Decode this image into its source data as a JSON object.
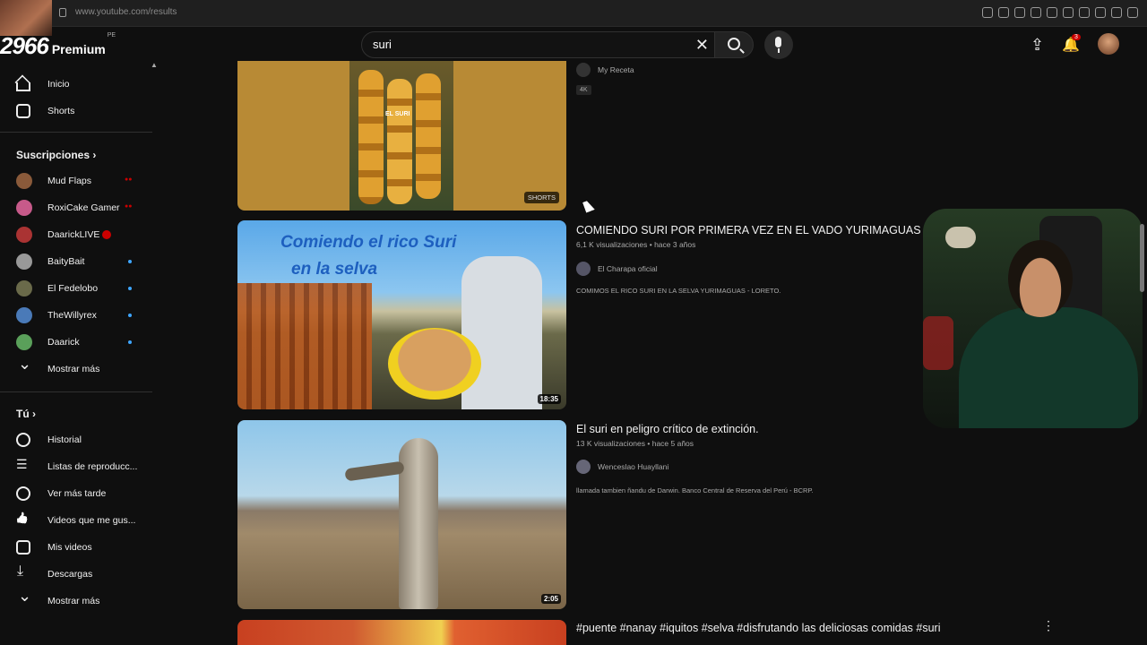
{
  "browser": {
    "url": "www.youtube.com/results"
  },
  "header": {
    "logo_number": "2966",
    "logo_label": "Premium",
    "logo_country": "PE",
    "search_value": "suri",
    "notification_count": "3"
  },
  "sidebar": {
    "main": [
      {
        "label": "Inicio",
        "icon": "home-icon"
      },
      {
        "label": "Shorts",
        "icon": "shorts-icon"
      }
    ],
    "subscriptions_header": "Suscripciones",
    "subscriptions": [
      {
        "label": "Mud Flaps",
        "color": "#8a5a3a"
      },
      {
        "label": "RoxiCake Gamer",
        "color": "#c75a8a"
      },
      {
        "label": "DaarickLIVE",
        "color": "#a33"
      },
      {
        "label": "BaityBait",
        "color": "#999"
      },
      {
        "label": "El Fedelobo",
        "color": "#6a6a4a"
      },
      {
        "label": "TheWillyrex",
        "color": "#4a7ab8"
      },
      {
        "label": "Daarick",
        "color": "#5aa05a"
      }
    ],
    "show_more_1": "Mostrar más",
    "you_header": "Tú",
    "you_items": [
      {
        "label": "Historial"
      },
      {
        "label": "Listas de reproducc..."
      },
      {
        "label": "Ver más tarde"
      },
      {
        "label": "Videos que me gus..."
      },
      {
        "label": "Mis videos"
      },
      {
        "label": "Descargas"
      }
    ],
    "show_more_2": "Mostrar más"
  },
  "results": [
    {
      "channel": "My Receta",
      "tag": "4K",
      "badge": "SHORTS",
      "thumb_overlay": "EL SURI"
    },
    {
      "title": "COMIENDO SURI POR PRIMERA VEZ EN EL VADO YURIMAGUAS - LORETO",
      "meta": "6,1 K visualizaciones • hace 3 años",
      "channel": "El Charapa oficial",
      "description": "COMIMOS EL RICO SURI EN LA SELVA YURIMAGUAS - LORETO.",
      "duration": "18:35",
      "thumb_line1": "Comiendo el rico Suri",
      "thumb_line2": "en la selva"
    },
    {
      "title": "El suri en peligro crítico de extinción.",
      "meta": "13 K visualizaciones • hace 5 años",
      "channel": "Wenceslao Huayllani",
      "description": "llamada tambien ñandu de Darwin. Banco Central de Reserva del Perú - BCRP.",
      "duration": "2:05"
    },
    {
      "title": "#puente #nanay #iquitos #selva #disfrutando las deliciosas comidas #suri"
    }
  ],
  "colors": {
    "accent_red": "#cc0000",
    "new_dot": "#3ea6ff",
    "background": "#0f0f0f"
  }
}
